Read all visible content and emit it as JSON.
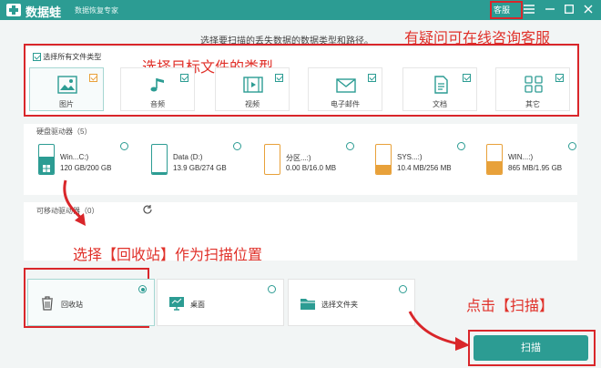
{
  "titlebar": {
    "app_name": "数据蛙",
    "subtitle": "数据恢复专家",
    "service": "客服",
    "menu_icon": "menu-icon",
    "min_icon": "minimize-icon",
    "max_icon": "maximize-icon",
    "close_icon": "close-icon"
  },
  "instruction": "选择要扫描的丢失数据的数据类型和路径。",
  "annotations": {
    "service_hint": "有疑问可在线咨询客服",
    "filetype_hint": "选择目标文件的类型",
    "recycle_hint": "选择【回收站】作为扫描位置",
    "scan_hint": "点击【扫描】"
  },
  "filetypes": {
    "select_all": "选择所有文件类型",
    "items": [
      {
        "label": "图片",
        "icon": "image-icon"
      },
      {
        "label": "音频",
        "icon": "audio-icon"
      },
      {
        "label": "视频",
        "icon": "video-icon"
      },
      {
        "label": "电子邮件",
        "icon": "email-icon"
      },
      {
        "label": "文档",
        "icon": "document-icon"
      },
      {
        "label": "其它",
        "icon": "other-icon"
      }
    ]
  },
  "disks": {
    "title": "硬盘驱动器（5）",
    "items": [
      {
        "name": "Win...C:)",
        "size": "120 GB/200 GB",
        "used_fraction": 0.6
      },
      {
        "name": "Data (D:)",
        "size": "13.9 GB/274 GB",
        "used_fraction": 0.05
      },
      {
        "name": "分区...:)",
        "size": "0.00 B/16.0 MB",
        "used_fraction": 0.0
      },
      {
        "name": "SYS...:)",
        "size": "10.4 MB/256 MB",
        "used_fraction": 0.3
      },
      {
        "name": "WIN...:)",
        "size": "865 MB/1.95 GB",
        "used_fraction": 0.45
      }
    ]
  },
  "removable": {
    "title": "可移动驱动器（0）"
  },
  "locations": [
    {
      "label": "回收站",
      "icon": "recycle-bin-icon",
      "selected": true
    },
    {
      "label": "桌面",
      "icon": "desktop-icon",
      "selected": false
    },
    {
      "label": "选择文件夹",
      "icon": "folder-icon",
      "selected": false
    }
  ],
  "scan_button": "扫描",
  "colors": {
    "accent": "#2c9c93",
    "annotation": "#e0312a",
    "warning": "#e8a13a"
  }
}
